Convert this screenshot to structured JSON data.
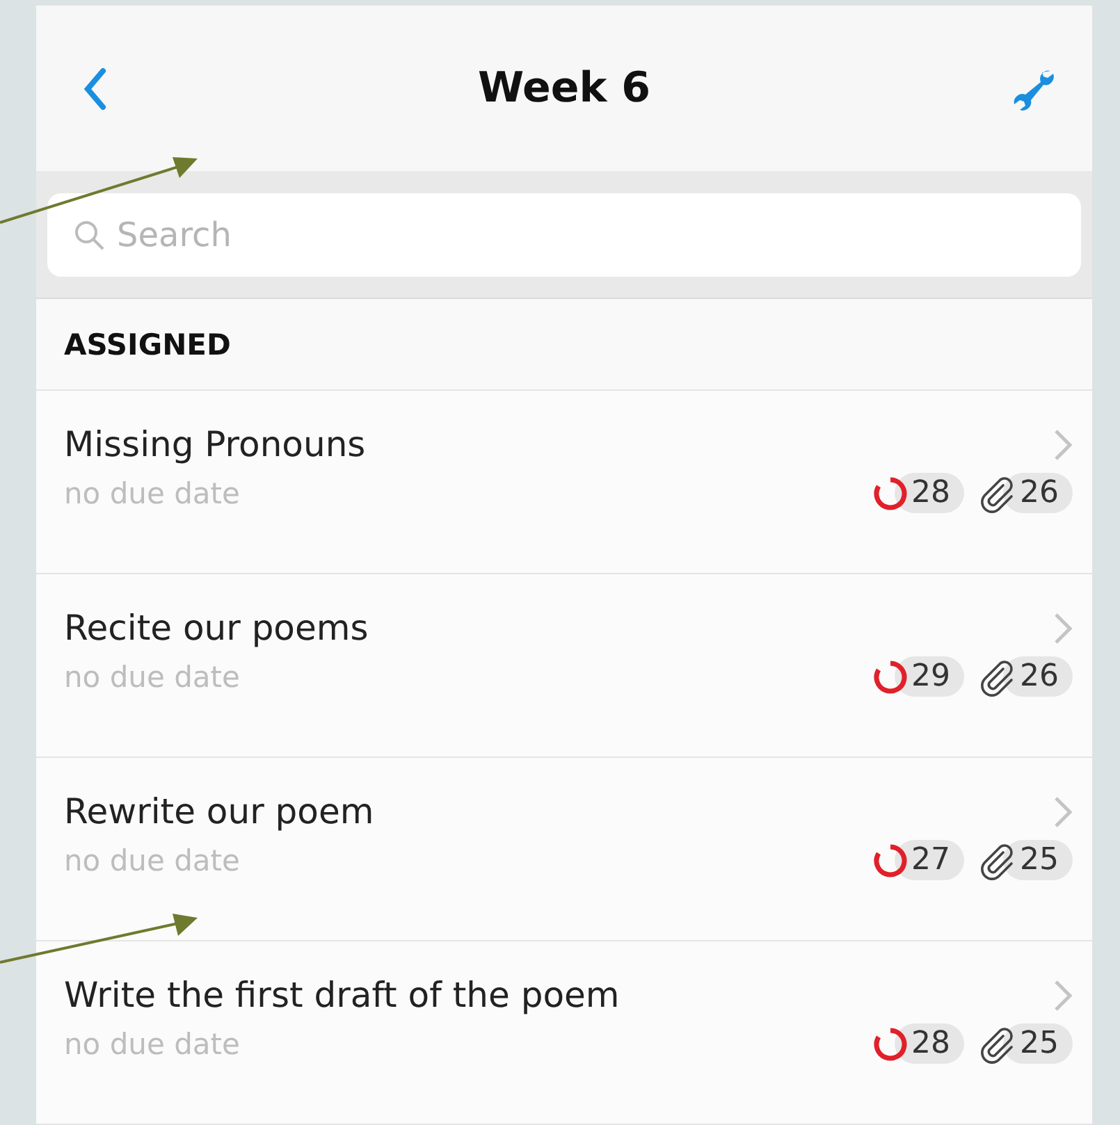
{
  "nav": {
    "title": "Week 6"
  },
  "search": {
    "placeholder": "Search"
  },
  "section": {
    "title": "ASSIGNED"
  },
  "assignments": [
    {
      "title": "Missing Pronouns",
      "due": "no due date",
      "progress_count": "28",
      "attachment_count": "26"
    },
    {
      "title": "Recite our poems",
      "due": "no due date",
      "progress_count": "29",
      "attachment_count": "26"
    },
    {
      "title": "Rewrite our poem",
      "due": "no due date",
      "progress_count": "27",
      "attachment_count": "25"
    },
    {
      "title": "Write the first draft of the poem",
      "due": "no due date",
      "progress_count": "28",
      "attachment_count": "25"
    }
  ]
}
